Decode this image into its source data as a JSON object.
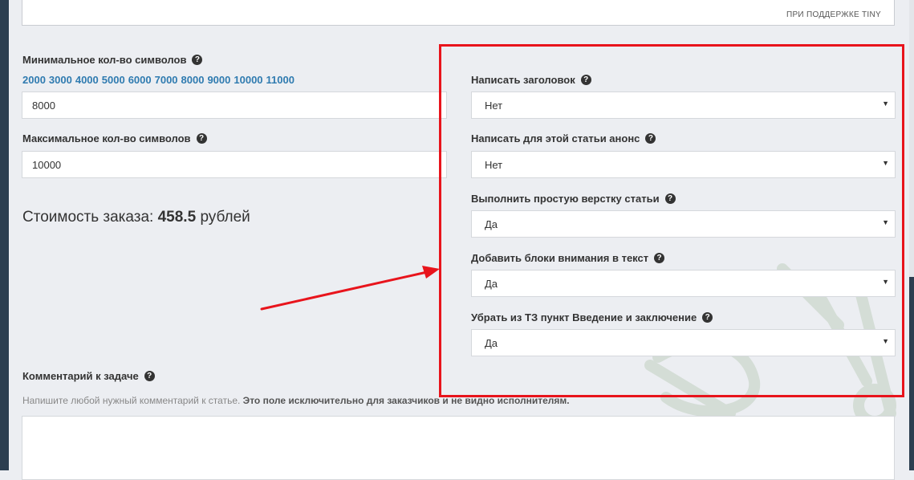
{
  "editor": {
    "powered_by": "ПРИ ПОДДЕРЖКЕ TINY"
  },
  "min_chars": {
    "label": "Минимальное кол-во символов",
    "help_icon": "question-circle-icon",
    "presets": [
      "2000",
      "3000",
      "4000",
      "5000",
      "6000",
      "7000",
      "8000",
      "9000",
      "10000",
      "11000"
    ],
    "value": "8000"
  },
  "max_chars": {
    "label": "Максимальное кол-во символов",
    "help_icon": "question-circle-icon",
    "value": "10000"
  },
  "price": {
    "prefix": "Стоимость заказа:",
    "amount": "458.5",
    "currency": "рублей"
  },
  "options": [
    {
      "label": "Написать заголовок",
      "value": "Нет"
    },
    {
      "label": "Написать для этой статьи анонс",
      "value": "Нет"
    },
    {
      "label": "Выполнить простую верстку статьи",
      "value": "Да"
    },
    {
      "label": "Добавить блоки внимания в текст",
      "value": "Да"
    },
    {
      "label": "Убрать из ТЗ пункт Введение и заключение",
      "value": "Да"
    }
  ],
  "comment": {
    "label": "Комментарий к задаче",
    "hint_normal": "Напишите любой нужный комментарий к статье.",
    "hint_bold": "Это поле исключительно для заказчиков и не видно исполнителям.",
    "value": ""
  },
  "colors": {
    "accent_link": "#2f7bb0",
    "highlight": "#e8141c",
    "sidebar": "#2c3e50",
    "background": "#eceef2"
  }
}
